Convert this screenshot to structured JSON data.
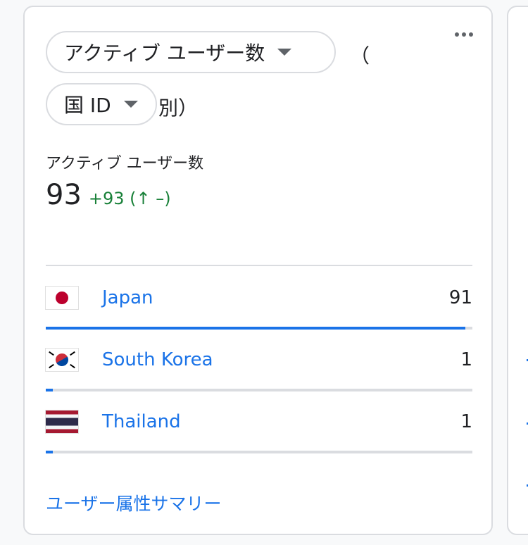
{
  "card": {
    "metric_dropdown": "アクティブ ユーザー数",
    "paren_open": "（",
    "dimension_dropdown": "国 ID",
    "paren_close": "別）",
    "metric_label": "アクティブ ユーザー数",
    "metric_value": "93",
    "metric_change": "+93 (↑ –)",
    "rows": [
      {
        "country": "Japan",
        "value": "91",
        "share": 0.984,
        "flag": "japan-flag-icon"
      },
      {
        "country": "South Korea",
        "value": "1",
        "share": 0.016,
        "flag": "south-korea-flag-icon"
      },
      {
        "country": "Thailand",
        "value": "1",
        "share": 0.016,
        "flag": "thailand-flag-icon"
      }
    ],
    "footer_link": "ユーザー属性サマリー"
  },
  "colors": {
    "accent": "#1a73e8",
    "positive": "#188038",
    "border": "#dadce0"
  }
}
